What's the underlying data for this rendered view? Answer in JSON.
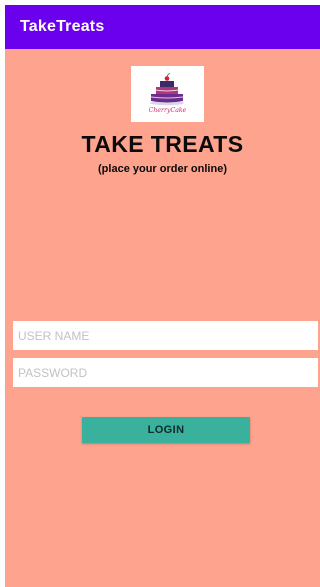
{
  "app_bar": {
    "title": "TakeTreats"
  },
  "logo": {
    "icon": "cake-logo-icon",
    "text": "CherryCake"
  },
  "brand": {
    "title": "TAKE TREATS",
    "subtitle": "(place your order online)"
  },
  "form": {
    "username_placeholder": "USER NAME",
    "password_placeholder": "PASSWORD",
    "login_label": "LOGIN"
  },
  "colors": {
    "app_bar": "#6a00ee",
    "background": "#fea38e",
    "button": "#3ab19d"
  }
}
